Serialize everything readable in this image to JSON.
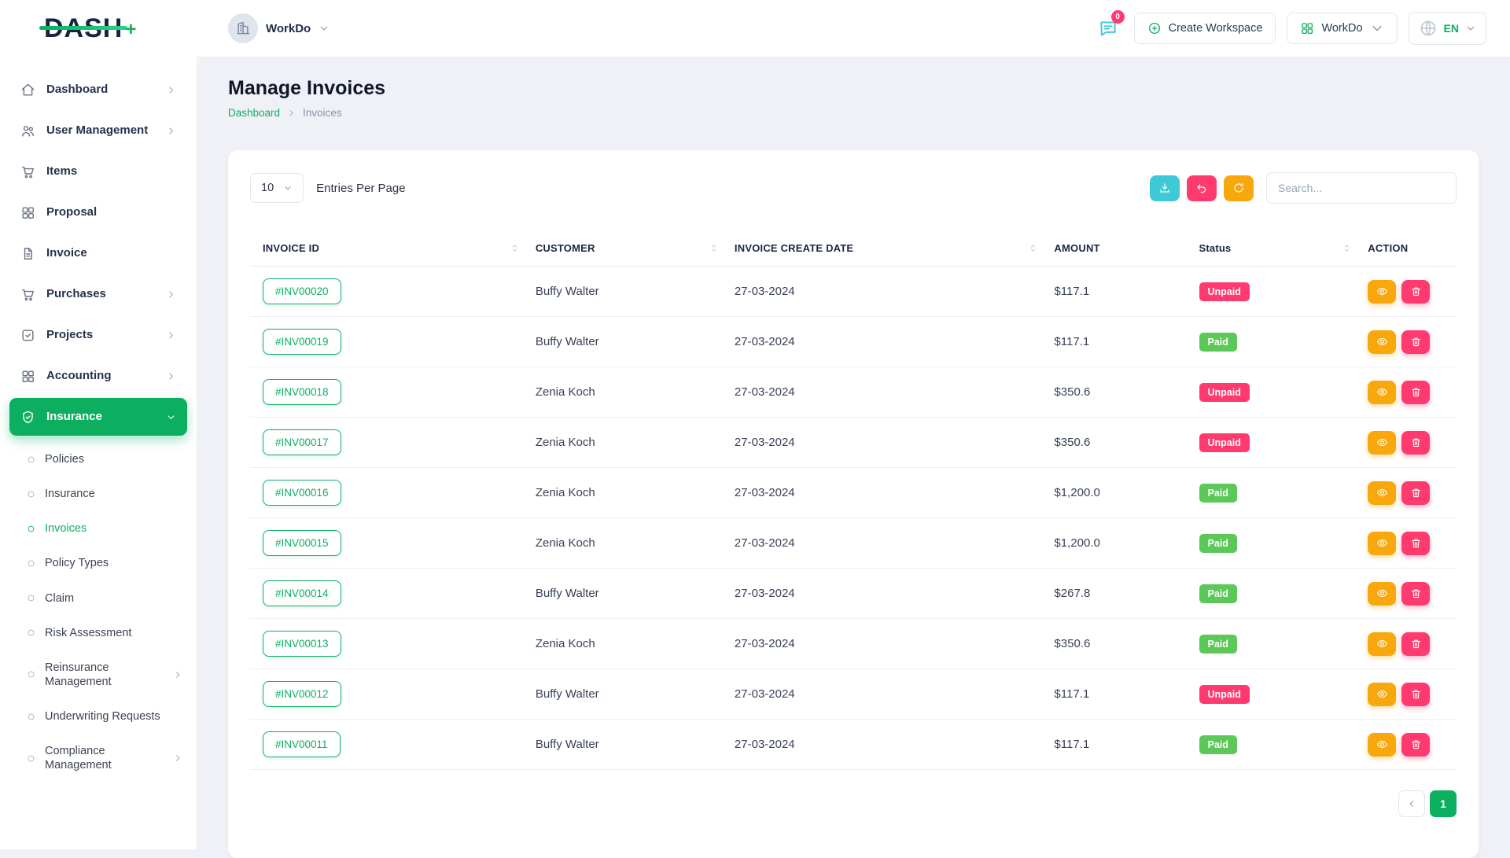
{
  "header": {
    "logo_text": "DASH",
    "workspace_name": "WorkDo",
    "messages_badge": "0",
    "create_workspace_label": "Create Workspace",
    "workspace_menu_label": "WorkDo",
    "language_code": "EN"
  },
  "sidebar": {
    "items": [
      {
        "label": "Dashboard"
      },
      {
        "label": "User Management"
      },
      {
        "label": "Items"
      },
      {
        "label": "Proposal"
      },
      {
        "label": "Invoice"
      },
      {
        "label": "Purchases"
      },
      {
        "label": "Projects"
      },
      {
        "label": "Accounting"
      },
      {
        "label": "Insurance"
      }
    ],
    "insurance_submenu": [
      {
        "label": "Policies"
      },
      {
        "label": "Insurance"
      },
      {
        "label": "Invoices"
      },
      {
        "label": "Policy Types"
      },
      {
        "label": "Claim"
      },
      {
        "label": "Risk Assessment"
      },
      {
        "label": "Reinsurance Management"
      },
      {
        "label": "Underwriting Requests"
      },
      {
        "label": "Compliance Management"
      }
    ]
  },
  "page": {
    "title": "Manage Invoices",
    "breadcrumb_home": "Dashboard",
    "breadcrumb_current": "Invoices"
  },
  "toolbar": {
    "entries_per_page_value": "10",
    "entries_per_page_label": "Entries Per Page",
    "search_placeholder": "Search..."
  },
  "table": {
    "headers": {
      "invoice_id": "INVOICE ID",
      "customer": "CUSTOMER",
      "date": "INVOICE CREATE DATE",
      "amount": "AMOUNT",
      "status": "Status",
      "action": "ACTION"
    },
    "rows": [
      {
        "id": "#INV00020",
        "customer": "Buffy Walter",
        "date": "27-03-2024",
        "amount": "$117.1",
        "status": "Unpaid"
      },
      {
        "id": "#INV00019",
        "customer": "Buffy Walter",
        "date": "27-03-2024",
        "amount": "$117.1",
        "status": "Paid"
      },
      {
        "id": "#INV00018",
        "customer": "Zenia Koch",
        "date": "27-03-2024",
        "amount": "$350.6",
        "status": "Unpaid"
      },
      {
        "id": "#INV00017",
        "customer": "Zenia Koch",
        "date": "27-03-2024",
        "amount": "$350.6",
        "status": "Unpaid"
      },
      {
        "id": "#INV00016",
        "customer": "Zenia Koch",
        "date": "27-03-2024",
        "amount": "$1,200.0",
        "status": "Paid"
      },
      {
        "id": "#INV00015",
        "customer": "Zenia Koch",
        "date": "27-03-2024",
        "amount": "$1,200.0",
        "status": "Paid"
      },
      {
        "id": "#INV00014",
        "customer": "Buffy Walter",
        "date": "27-03-2024",
        "amount": "$267.8",
        "status": "Paid"
      },
      {
        "id": "#INV00013",
        "customer": "Zenia Koch",
        "date": "27-03-2024",
        "amount": "$350.6",
        "status": "Paid"
      },
      {
        "id": "#INV00012",
        "customer": "Buffy Walter",
        "date": "27-03-2024",
        "amount": "$117.1",
        "status": "Unpaid"
      },
      {
        "id": "#INV00011",
        "customer": "Buffy Walter",
        "date": "27-03-2024",
        "amount": "$117.1",
        "status": "Paid"
      }
    ]
  },
  "pagination": {
    "current_page": "1"
  },
  "colors": {
    "primary_green": "#0caf60",
    "paid_badge": "#5cc858",
    "unpaid_badge": "#ff3a6e",
    "export_button": "#3ec9d6",
    "reset_button": "#ff3a6e",
    "refresh_button": "#f8a80c"
  },
  "icons": {
    "messages": "chat-bubble",
    "create_workspace": "plus-circle",
    "workspace_menu": "grid",
    "language": "globe",
    "export": "download",
    "reset": "undo-arrow",
    "refresh": "refresh-arrows",
    "view": "eye",
    "delete": "trash",
    "sort": "up-down-arrows"
  }
}
